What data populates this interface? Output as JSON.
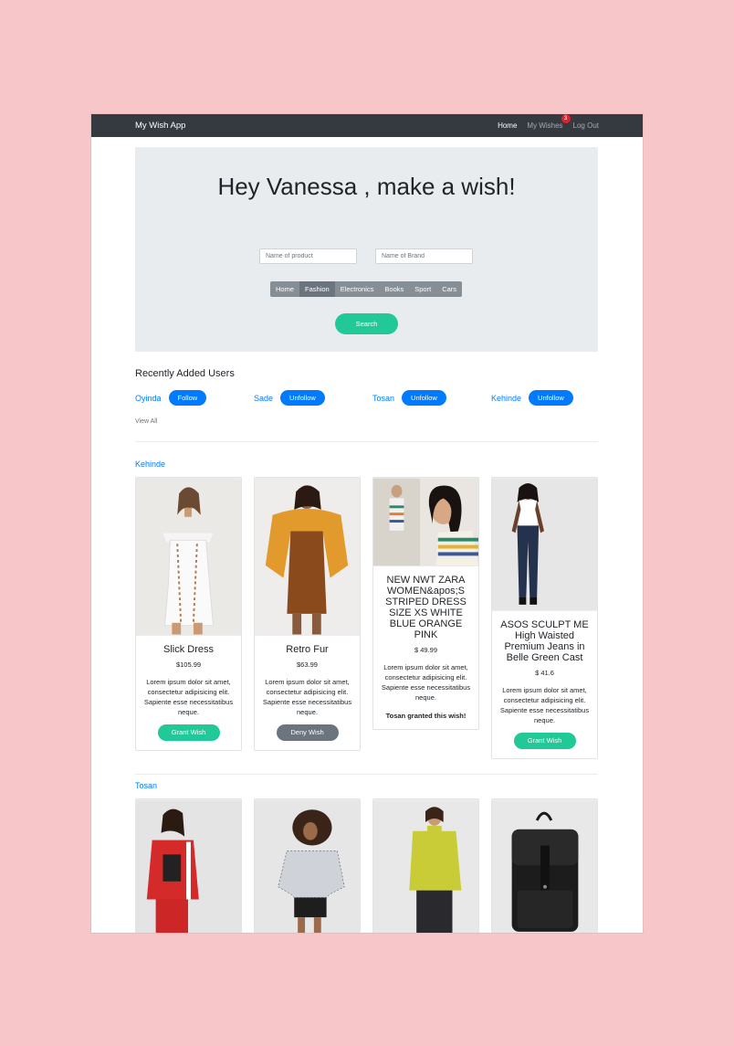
{
  "navbar": {
    "brand": "My Wish App",
    "links": [
      {
        "label": "Home",
        "active": true
      },
      {
        "label": "My Wishes",
        "badge": "3"
      },
      {
        "label": "Log Out"
      }
    ]
  },
  "hero": {
    "title": "Hey Vanessa , make a wish!",
    "product_placeholder": "Name of product",
    "brand_placeholder": "Name of Brand",
    "categories": [
      "Home",
      "Fashion",
      "Electronics",
      "Books",
      "Sport",
      "Cars"
    ],
    "active_category": "Fashion",
    "search_label": "Search"
  },
  "recent_users": {
    "title": "Recently Added Users",
    "users": [
      {
        "name": "Oyinda",
        "action": "Follow"
      },
      {
        "name": "Sade",
        "action": "Unfollow"
      },
      {
        "name": "Tosan",
        "action": "Unfollow"
      },
      {
        "name": "Kehinde",
        "action": "Unfollow"
      }
    ],
    "view_all": "View All"
  },
  "wish_groups": [
    {
      "user": "Kehinde",
      "items": [
        {
          "title": "Slick Dress",
          "price": "$105.99",
          "description": "Lorem ipsum dolor sit amet, consectetur adipisicing elit. Sapiente esse necessitatibus neque.",
          "action": "Grant Wish"
        },
        {
          "title": "Retro Fur",
          "price": "$63.99",
          "description": "Lorem ipsum dolor sit amet, consectetur adipisicing elit. Sapiente esse necessitatibus neque.",
          "action": "Deny Wish"
        },
        {
          "title": "NEW NWT ZARA WOMEN&apos;S STRIPED DRESS SIZE XS WHITE BLUE ORANGE PINK",
          "price": "$ 49.99",
          "description": "Lorem ipsum dolor sit amet, consectetur adipisicing elit. Sapiente esse necessitatibus neque.",
          "status": "Tosan granted this wish!"
        },
        {
          "title": "ASOS SCULPT ME High Waisted Premium Jeans in Belle Green Cast",
          "price": "$ 41.6",
          "description": "Lorem ipsum dolor sit amet, consectetur adipisicing elit. Sapiente esse necessitatibus neque.",
          "action": "Grant Wish"
        }
      ]
    },
    {
      "user": "Tosan"
    }
  ],
  "colors": {
    "navbar": "#343a40",
    "link": "#007bff",
    "success": "#20c997",
    "secondary": "#6c757d",
    "badge": "#e3202a",
    "backdrop": "#f6c6c8"
  }
}
